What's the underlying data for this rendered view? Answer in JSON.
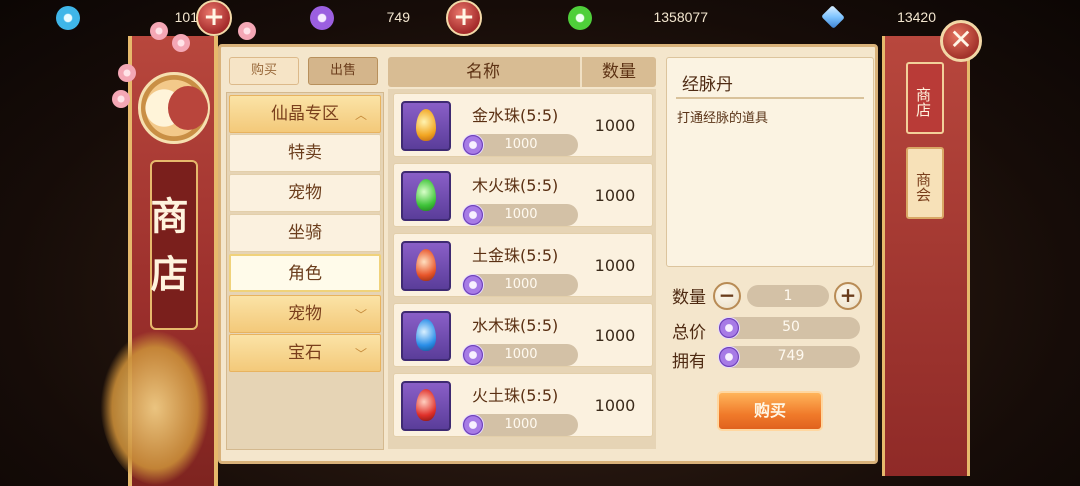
{
  "currencies": [
    {
      "icon": "blue-orb-icon",
      "amount": "101",
      "color": "#3fb6e8"
    },
    {
      "icon": "purple-orb-icon",
      "amount": "749",
      "color": "#9b5fe0"
    },
    {
      "icon": "green-orb-icon",
      "amount": "1358077",
      "color": "#4fcf3a"
    },
    {
      "icon": "diamond-icon",
      "amount": "13420",
      "color": "#7fc4ff"
    }
  ],
  "plus_symbol": "+",
  "banner": {
    "title": "商店"
  },
  "tabs": {
    "buy": "购买",
    "sell": "出售"
  },
  "categories": [
    {
      "label": "仙晶专区",
      "type": "header"
    },
    {
      "label": "特卖",
      "type": "item"
    },
    {
      "label": "宠物",
      "type": "item"
    },
    {
      "label": "坐骑",
      "type": "item"
    },
    {
      "label": "角色",
      "type": "selected"
    },
    {
      "label": "宠物",
      "type": "header"
    },
    {
      "label": "宝石",
      "type": "header"
    }
  ],
  "list_header": {
    "name": "名称",
    "quantity": "数量"
  },
  "items": [
    {
      "name": "金水珠(5:5)",
      "price": "1000",
      "quantity": "1000",
      "pearl_color": "#f2a622",
      "icon": "gold-water-pearl-icon"
    },
    {
      "name": "木火珠(5:5)",
      "price": "1000",
      "quantity": "1000",
      "pearl_color": "#3fc43a",
      "icon": "wood-fire-pearl-icon"
    },
    {
      "name": "土金珠(5:5)",
      "price": "1000",
      "quantity": "1000",
      "pearl_color": "#e8552a",
      "icon": "earth-gold-pearl-icon"
    },
    {
      "name": "水木珠(5:5)",
      "price": "1000",
      "quantity": "1000",
      "pearl_color": "#2a8ee8",
      "icon": "water-wood-pearl-icon"
    },
    {
      "name": "火土珠(5:5)",
      "price": "1000",
      "quantity": "1000",
      "pearl_color": "#e0302a",
      "icon": "fire-earth-pearl-icon"
    }
  ],
  "detail": {
    "title": "经脉丹",
    "description": "打通经脉的道具",
    "quantity_label": "数量",
    "quantity_value": "1",
    "minus": "−",
    "plus": "+",
    "total_label": "总价",
    "total_value": "50",
    "owned_label": "拥有",
    "owned_value": "749",
    "buy_button": "购买"
  },
  "side_tabs": {
    "shop": "商店",
    "guild": "商会"
  },
  "close_symbol": "✕"
}
